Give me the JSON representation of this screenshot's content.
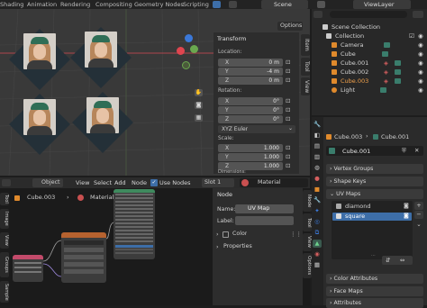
{
  "workspace_tabs": [
    "Shading",
    "Animation",
    "Rendering",
    "Compositing",
    "Geometry Nodes",
    "Scripting"
  ],
  "scene_name": "Scene",
  "view_layer": "ViewLayer",
  "viewport": {
    "options_label": "Options",
    "transform": {
      "title": "Transform",
      "location_label": "Location:",
      "location": [
        {
          "axis": "X",
          "value": "0 m"
        },
        {
          "axis": "Y",
          "value": "-4 m"
        },
        {
          "axis": "Z",
          "value": "0 m"
        }
      ],
      "rotation_label": "Rotation:",
      "rotation": [
        {
          "axis": "X",
          "value": "0°"
        },
        {
          "axis": "Y",
          "value": "0°"
        },
        {
          "axis": "Z",
          "value": "0°"
        }
      ],
      "rotation_mode": "XYZ Euler",
      "scale_label": "Scale:",
      "scale": [
        {
          "axis": "X",
          "value": "1.000"
        },
        {
          "axis": "Y",
          "value": "1.000"
        },
        {
          "axis": "Z",
          "value": "1.000"
        }
      ],
      "dimensions_label": "Dimensions:"
    },
    "side_tabs": [
      "Item",
      "Tool",
      "View"
    ]
  },
  "outliner": {
    "rows": [
      {
        "name": "Scene Collection"
      },
      {
        "name": "Collection"
      },
      {
        "name": "Camera"
      },
      {
        "name": "Cube"
      },
      {
        "name": "Cube.001"
      },
      {
        "name": "Cube.002"
      },
      {
        "name": "Cube.003"
      },
      {
        "name": "Light"
      }
    ]
  },
  "properties": {
    "breadcrumb_object": "Cube.003",
    "breadcrumb_mesh": "Cube.001",
    "mesh_name": "Cube.001",
    "sections": {
      "vertex_groups": "Vertex Groups",
      "shape_keys": "Shape Keys",
      "uv_maps": "UV Maps",
      "color_attributes": "Color Attributes",
      "face_maps": "Face Maps",
      "attributes": "Attributes"
    },
    "uv_maps": [
      {
        "name": "diamond"
      },
      {
        "name": "square"
      }
    ]
  },
  "node_editor": {
    "object_mode": "Object",
    "menus": [
      "View",
      "Select",
      "Add",
      "Node"
    ],
    "use_nodes_label": "Use Nodes",
    "slot": "Slot 1",
    "material_name": "Material",
    "object_name": "Cube.003",
    "breadcrumb_material": "Material",
    "left_tabs": [
      "Tool",
      "Image",
      "View",
      "Groups",
      "Sample"
    ],
    "side_panel": {
      "node_title": "Node",
      "name_label": "Name:",
      "name_value": "UV Map",
      "label_label": "Label:",
      "color_label": "Color",
      "properties_label": "Properties"
    },
    "side_tabs": [
      "Node",
      "Tool",
      "View",
      "Options"
    ]
  },
  "colors": {
    "accent_blue": "#3d6ea8",
    "axis_x": "#e0454f",
    "axis_y": "#6aa84f",
    "axis_z": "#3b78d8",
    "selected_orange": "#e08a2c"
  }
}
